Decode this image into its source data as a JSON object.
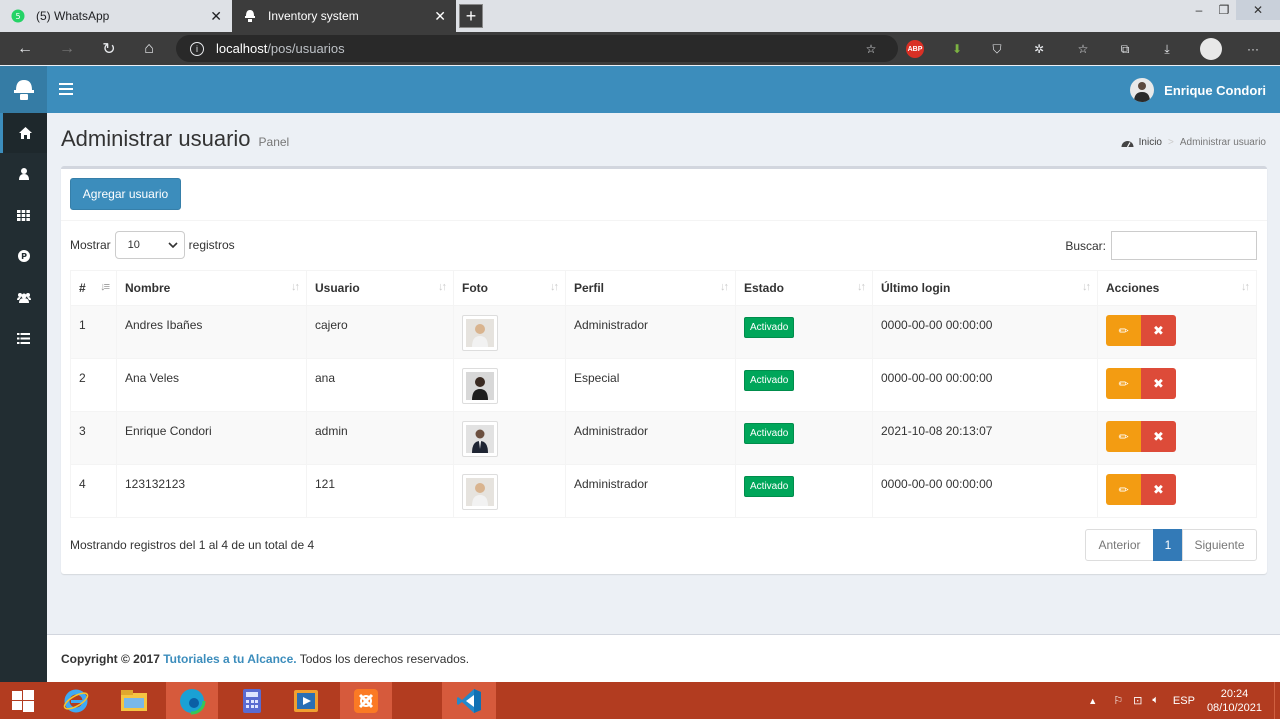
{
  "browser": {
    "tabs": [
      {
        "label": "(5) WhatsApp",
        "icon": "whatsapp-icon"
      },
      {
        "label": "Inventory system",
        "icon": "helmet-icon"
      }
    ],
    "url_host": "localhost",
    "url_path": "/pos/usuarios",
    "abp_label": "ABP"
  },
  "header": {
    "user_name": "Enrique Condori"
  },
  "sidebar": {
    "items": [
      {
        "icon": "home-icon",
        "active": true
      },
      {
        "icon": "user-icon"
      },
      {
        "icon": "grid-icon"
      },
      {
        "icon": "product-icon"
      },
      {
        "icon": "users-icon"
      },
      {
        "icon": "list-icon"
      }
    ]
  },
  "content": {
    "title": "Administrar usuario",
    "subtitle": "Panel",
    "breadcrumb_home": "Inicio",
    "breadcrumb_sep": ">",
    "breadcrumb_current": "Administrar usuario"
  },
  "box": {
    "add_button": "Agregar usuario",
    "show_label": "Mostrar",
    "show_value": "10",
    "records_label": "registros",
    "search_label": "Buscar:",
    "search_value": ""
  },
  "table": {
    "headers": [
      "#",
      "Nombre",
      "Usuario",
      "Foto",
      "Perfil",
      "Estado",
      "Último login",
      "Acciones"
    ],
    "rows": [
      {
        "id": "1",
        "nombre": "Andres Ibañes",
        "usuario": "cajero",
        "perfil": "Administrador",
        "estado": "Activado",
        "login": "0000-00-00 00:00:00"
      },
      {
        "id": "2",
        "nombre": "Ana Veles",
        "usuario": "ana",
        "perfil": "Especial",
        "estado": "Activado",
        "login": "0000-00-00 00:00:00"
      },
      {
        "id": "3",
        "nombre": "Enrique Condori",
        "usuario": "admin",
        "perfil": "Administrador",
        "estado": "Activado",
        "login": "2021-10-08 20:13:07"
      },
      {
        "id": "4",
        "nombre": "123132123",
        "usuario": "121",
        "perfil": "Administrador",
        "estado": "Activado",
        "login": "0000-00-00 00:00:00"
      }
    ]
  },
  "pagination": {
    "info": "Mostrando registros del 1 al 4 de un total de 4",
    "prev": "Anterior",
    "current": "1",
    "next": "Siguiente"
  },
  "footer": {
    "copyright": "Copyright © 2017",
    "link": "Tutoriales a tu Alcance.",
    "rights": "Todos los derechos reservados."
  },
  "taskbar": {
    "lang": "ESP",
    "time": "20:24",
    "date": "08/10/2021"
  },
  "colors": {
    "header": "#3c8dbc",
    "sidebar": "#222d32",
    "success": "#00a65a",
    "warning": "#f39c12",
    "danger": "#dd4b39",
    "taskbar": "#b23c20"
  }
}
